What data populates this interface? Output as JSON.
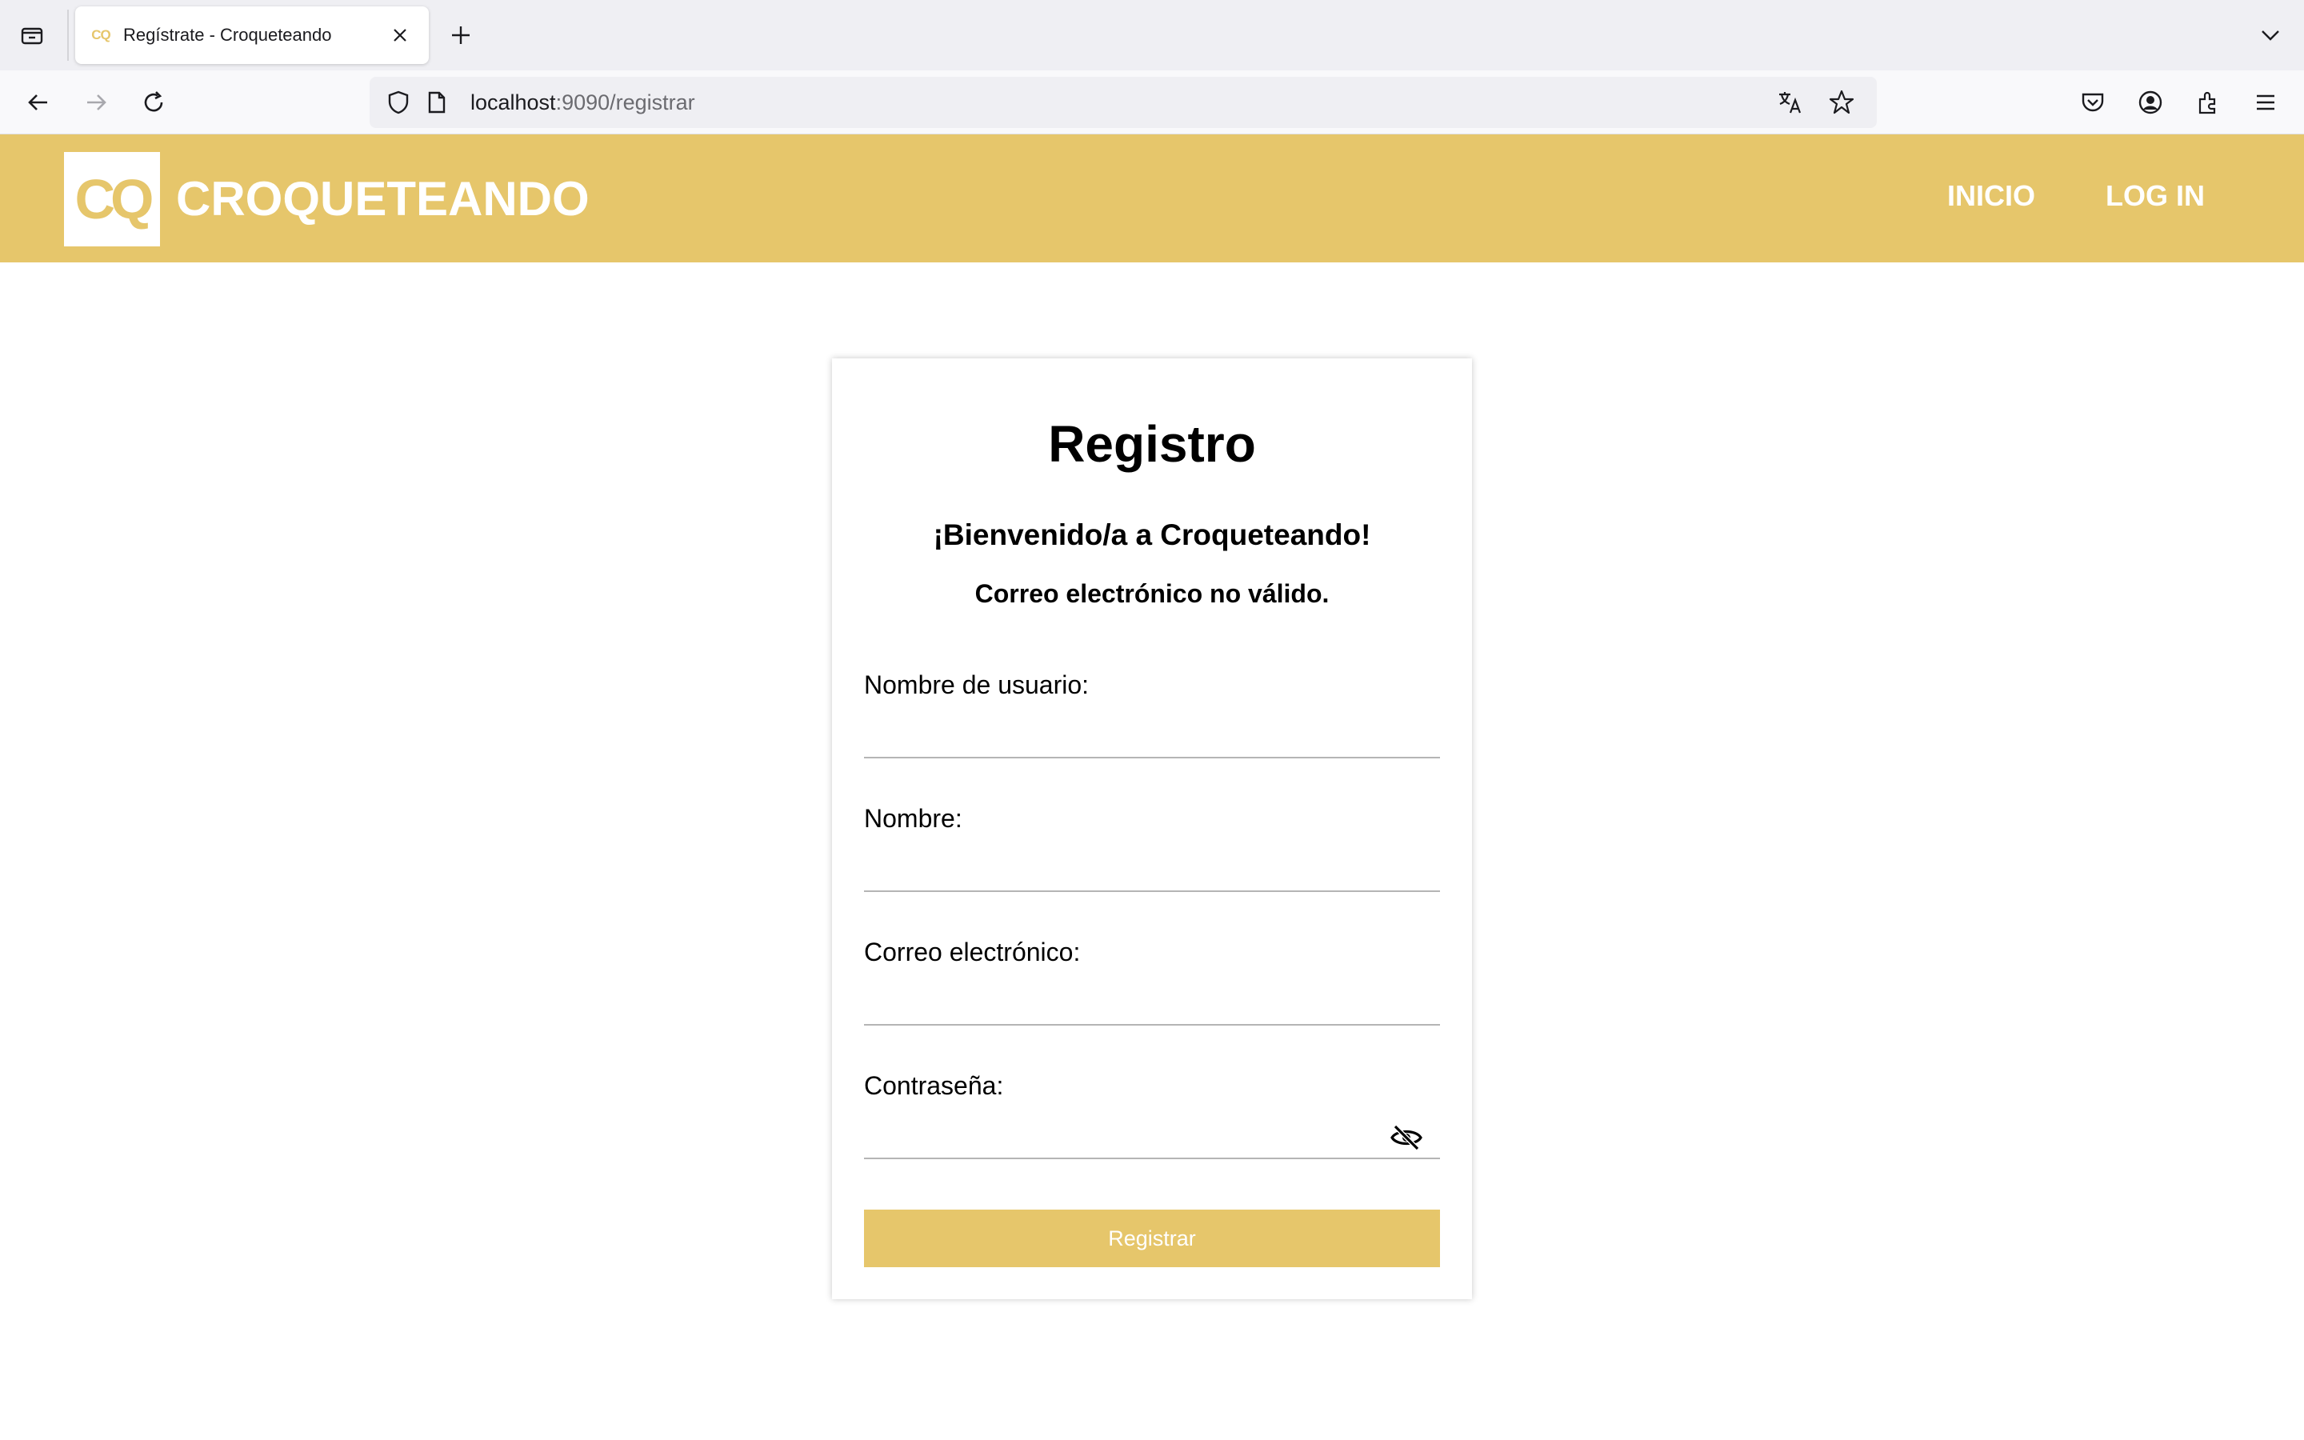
{
  "browser": {
    "tab_title": "Regístrate - Croqueteando",
    "tab_favicon_text": "CQ",
    "url_host": "localhost",
    "url_rest": ":9090/registrar"
  },
  "header": {
    "logo_text": "CQ",
    "brand": "CROQUETEANDO",
    "nav": [
      "INICIO",
      "LOG IN"
    ]
  },
  "form": {
    "title": "Registro",
    "welcome": "¡Bienvenido/a a Croqueteando!",
    "error": "Correo electrónico no válido.",
    "fields": [
      {
        "label": "Nombre de usuario:",
        "value": ""
      },
      {
        "label": "Nombre:",
        "value": ""
      },
      {
        "label": "Correo electrónico:",
        "value": ""
      },
      {
        "label": "Contraseña:",
        "value": ""
      }
    ],
    "submit_label": "Registrar"
  },
  "colors": {
    "brand": "#e6c66b"
  }
}
